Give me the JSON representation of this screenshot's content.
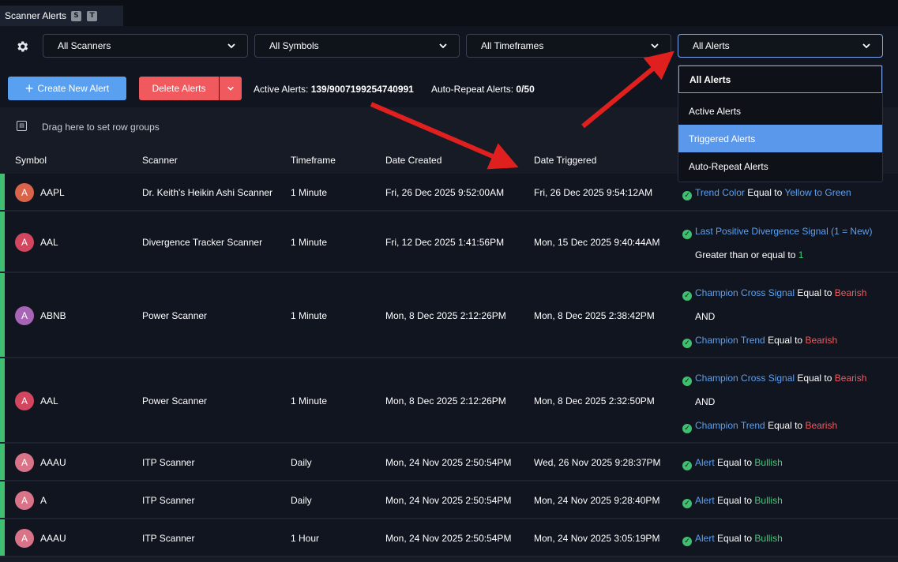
{
  "tab": {
    "title": "Scanner Alerts",
    "badge_s": "S",
    "badge_t": "T"
  },
  "filters": {
    "scanners": "All Scanners",
    "symbols": "All Symbols",
    "timeframes": "All Timeframes",
    "alerts": "All Alerts"
  },
  "actions": {
    "create_label": "Create New Alert",
    "delete_label": "Delete Alerts",
    "active_label": "Active Alerts:",
    "active_value": "139/9007199254740991",
    "autorepeat_label": "Auto-Repeat Alerts:",
    "autorepeat_value": "0/50"
  },
  "grid": {
    "group_hint": "Drag here to set row groups",
    "columns": [
      "Symbol",
      "Scanner",
      "Timeframe",
      "Date Created",
      "Date Triggered"
    ],
    "rows": [
      {
        "avatar": "A",
        "avatar_color": "#d9644a",
        "symbol": "AAPL",
        "scanner": "Dr. Keith's Heikin Ashi Scanner",
        "timeframe": "1 Minute",
        "created": "Fri, 26 Dec 2025 9:52:00AM",
        "triggered": "Fri, 26 Dec 2025 9:54:12AM",
        "cond": {
          "field": "Trend Color",
          "op": "Equal to",
          "value": "Yellow to Green"
        }
      },
      {
        "avatar": "A",
        "avatar_color": "#d2465e",
        "symbol": "AAL",
        "scanner": "Divergence Tracker Scanner",
        "timeframe": "1 Minute",
        "created": "Fri, 12 Dec 2025 1:41:56PM",
        "triggered": "Mon, 15 Dec 2025 9:40:44AM",
        "cond": {
          "field": "Last Positive Divergence Signal (1 = New)",
          "op": "Greater than or equal to",
          "value": "1"
        }
      },
      {
        "avatar": "A",
        "avatar_color": "#a965b5",
        "symbol": "ABNB",
        "scanner": "Power Scanner",
        "timeframe": "1 Minute",
        "created": "Mon, 8 Dec 2025 2:12:26PM",
        "triggered": "Mon, 8 Dec 2025 2:38:42PM",
        "cond1": {
          "field": "Champion Cross Signal",
          "op": "Equal to",
          "value": "Bearish"
        },
        "joiner": "AND",
        "cond2": {
          "field": "Champion Trend",
          "op": "Equal to",
          "value": "Bearish"
        }
      },
      {
        "avatar": "A",
        "avatar_color": "#d2465e",
        "symbol": "AAL",
        "scanner": "Power Scanner",
        "timeframe": "1 Minute",
        "created": "Mon, 8 Dec 2025 2:12:26PM",
        "triggered": "Mon, 8 Dec 2025 2:32:50PM",
        "cond1": {
          "field": "Champion Cross Signal",
          "op": "Equal to",
          "value": "Bearish"
        },
        "joiner": "AND",
        "cond2": {
          "field": "Champion Trend",
          "op": "Equal to",
          "value": "Bearish"
        }
      },
      {
        "avatar": "A",
        "avatar_color": "#d97388",
        "symbol": "AAAU",
        "scanner": "ITP Scanner",
        "timeframe": "Daily",
        "created": "Mon, 24 Nov 2025 2:50:54PM",
        "triggered": "Wed, 26 Nov 2025 9:28:37PM",
        "cond": {
          "field": "Alert",
          "op": "Equal to",
          "value": "Bullish"
        }
      },
      {
        "avatar": "A",
        "avatar_color": "#d97388",
        "symbol": "A",
        "scanner": "ITP Scanner",
        "timeframe": "Daily",
        "created": "Mon, 24 Nov 2025 2:50:54PM",
        "triggered": "Mon, 24 Nov 2025 9:28:40PM",
        "cond": {
          "field": "Alert",
          "op": "Equal to",
          "value": "Bullish"
        }
      },
      {
        "avatar": "A",
        "avatar_color": "#d97388",
        "symbol": "AAAU",
        "scanner": "ITP Scanner",
        "timeframe": "1 Hour",
        "created": "Mon, 24 Nov 2025 2:50:54PM",
        "triggered": "Mon, 24 Nov 2025 3:05:19PM",
        "cond": {
          "field": "Alert",
          "op": "Equal to",
          "value": "Bullish"
        }
      }
    ]
  },
  "menu": {
    "items": [
      "All Alerts",
      "Active Alerts",
      "Triggered Alerts",
      "Auto-Repeat Alerts"
    ],
    "selected": "All Alerts",
    "highlighted": "Triggered Alerts"
  },
  "annotation": {
    "arrow_color": "#e0201e"
  }
}
